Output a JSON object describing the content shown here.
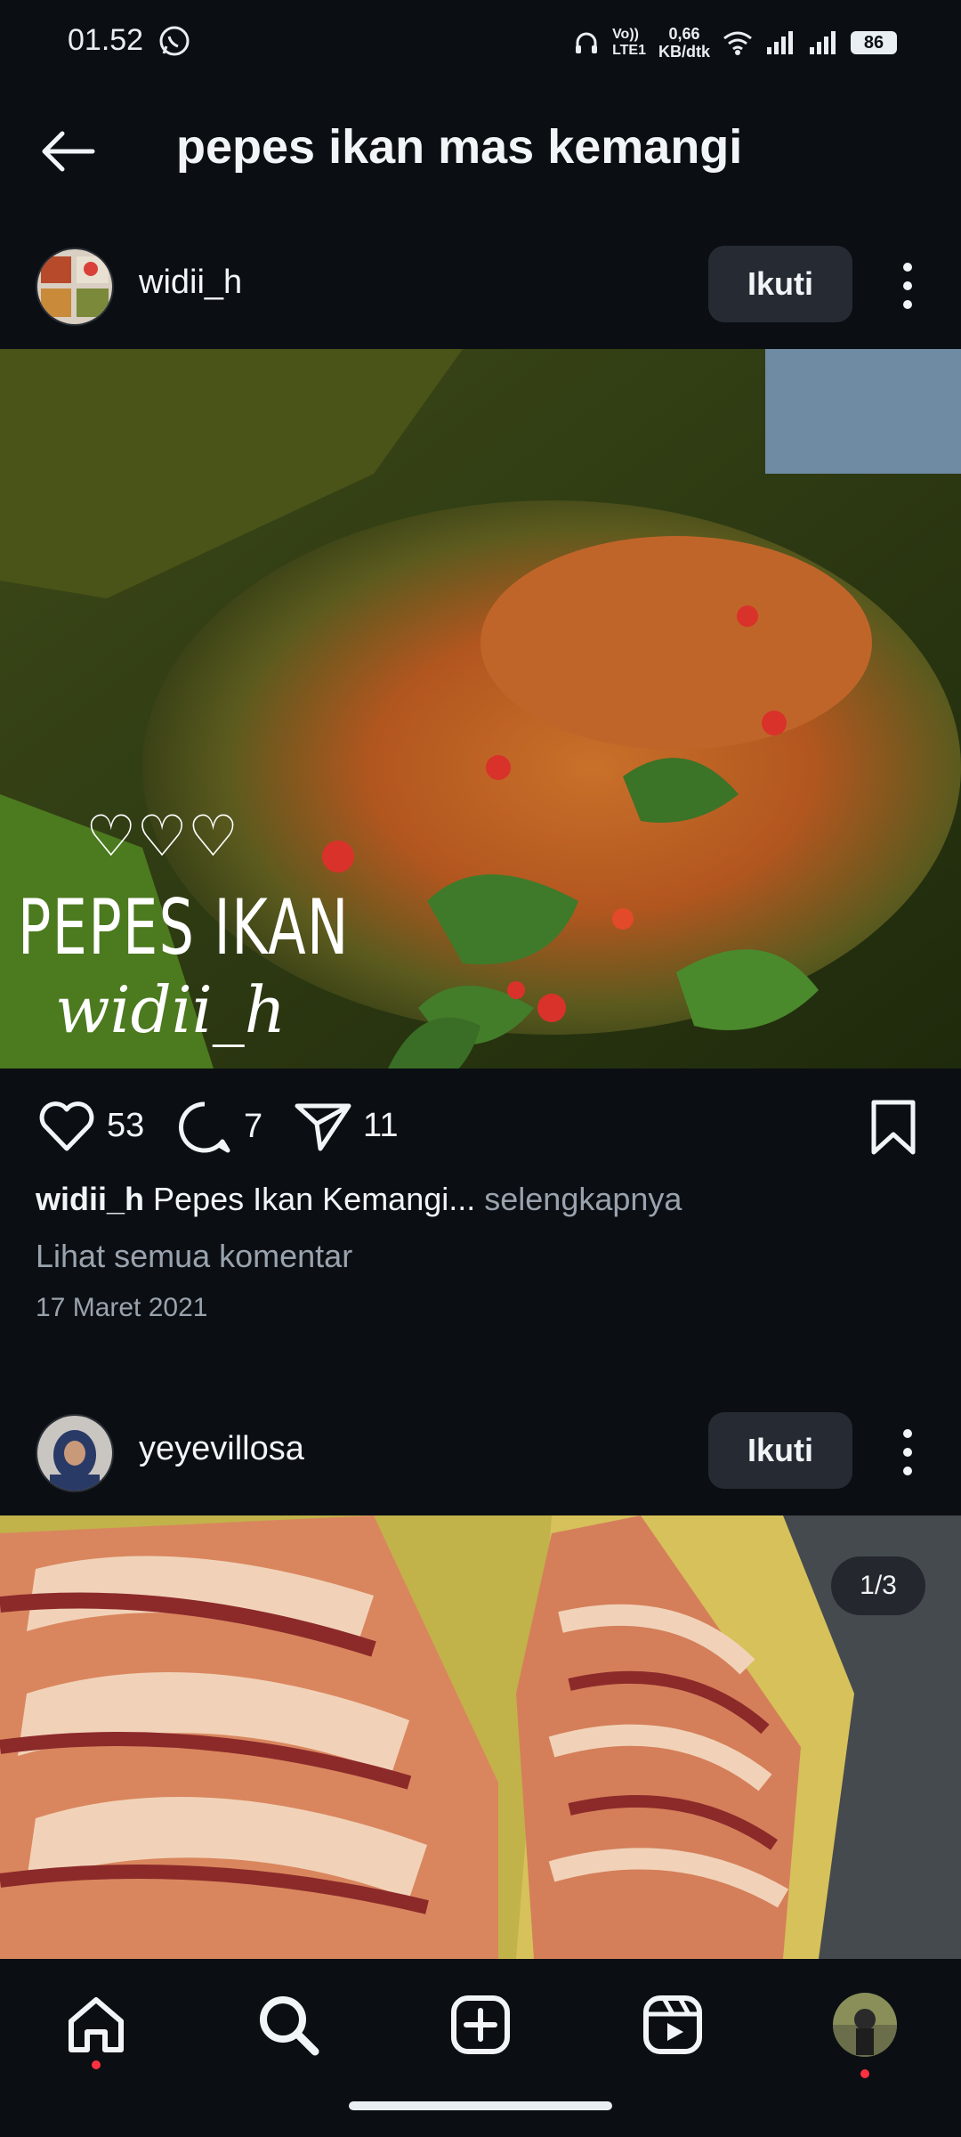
{
  "status_bar": {
    "time": "01.52",
    "network_speed_top": "0,66",
    "network_speed_bottom": "KB/dtk",
    "volte_top": "Vo))",
    "volte_bottom": "LTE1",
    "battery": "86"
  },
  "header": {
    "title": "pepes ikan mas kemangi"
  },
  "posts": [
    {
      "username": "widii_h",
      "follow_label": "Ikuti",
      "image_overlay_hearts": "♡♡♡",
      "image_overlay_line1": "PEPES IKAN",
      "image_overlay_line2": "widii_h",
      "likes": "53",
      "comments": "7",
      "shares": "11",
      "caption_user": "widii_h",
      "caption_text": "Pepes Ikan Kemangi...",
      "caption_more": " selengkapnya",
      "view_comments": "Lihat semua komentar",
      "date": "17 Maret 2021"
    },
    {
      "username": "yeyevillosa",
      "follow_label": "Ikuti",
      "carousel_indicator": "1/3"
    }
  ],
  "colors": {
    "background": "#0b0f14",
    "button_bg": "#262b33",
    "muted_text": "#9aa3ad",
    "notification_dot": "#ff3040"
  },
  "icons": {
    "nav": [
      "home-icon",
      "search-icon",
      "create-icon",
      "reels-icon",
      "profile-avatar"
    ]
  }
}
